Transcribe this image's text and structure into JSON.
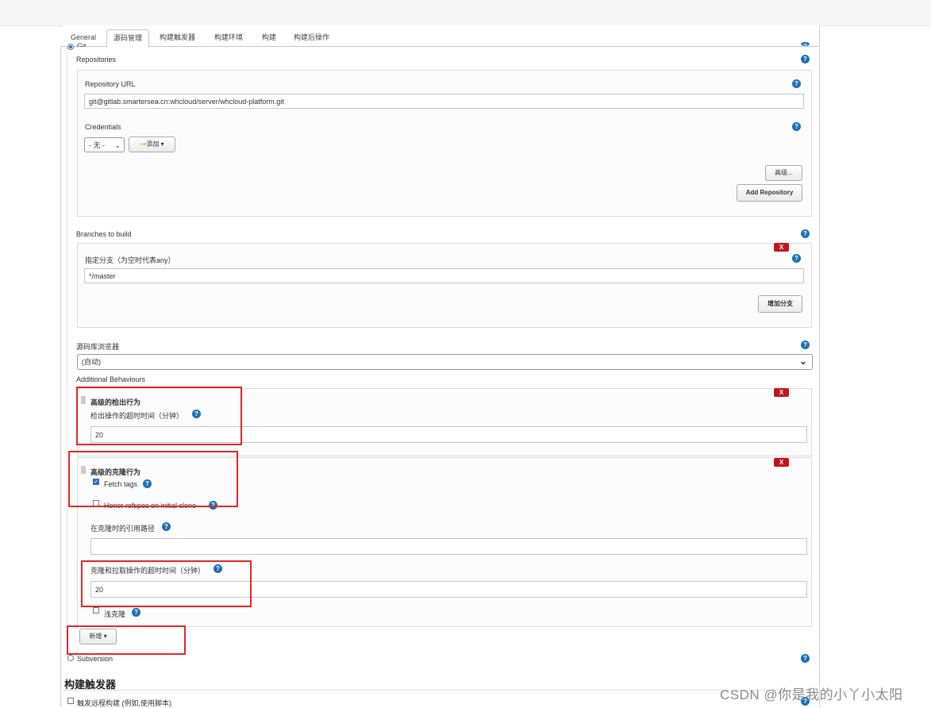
{
  "tabs": [
    "General",
    "源码管理",
    "构建触发器",
    "构建环境",
    "构建",
    "构建后操作"
  ],
  "active_tab_index": 1,
  "scm": {
    "git_radio_label": "Git",
    "repositories_label": "Repositories",
    "repository_url_label": "Repository URL",
    "repository_url_value": "git@gitlab.smartersea.cn:whcloud/server/whcloud-platform.git",
    "credentials_label": "Credentials",
    "credentials_select_value": "- 无 -",
    "add_credentials_label": "添加",
    "advanced_button": "高级...",
    "add_repository_button": "Add Repository",
    "branches_label": "Branches to build",
    "branch_specifier_label": "指定分支（为空时代表any）",
    "branch_specifier_value": "*/master",
    "add_branch_button": "增加分支",
    "repo_browser_label": "源码库浏览器",
    "repo_browser_value": "(自动)",
    "additional_behaviours_label": "Additional Behaviours",
    "checkout_behaviour_title": "高级的检出行为",
    "checkout_timeout_label": "检出操作的超时时间（分钟）",
    "checkout_timeout_value": "20",
    "clone_behaviour_title": "高级的克隆行为",
    "fetch_tags_label": "Fetch tags",
    "honor_refspec_label": "Honor refspec on initial clone",
    "reference_path_label": "在克隆时的引用路径",
    "reference_path_value": "",
    "clone_timeout_label": "克隆和拉取操作的超时时间（分钟）",
    "clone_timeout_value": "20",
    "shallow_clone_label": "浅克隆",
    "add_behaviour_button": "新增",
    "subversion_label": "Subversion",
    "delete_label": "X",
    "help_label": "?"
  },
  "trigger_section_title": "构建触发器",
  "trigger_remote_label": "触发远程构建 (例如,使用脚本)",
  "watermark": "CSDN @你是我的小丫小太阳",
  "colors": {
    "help": "#1d6fb4",
    "delete": "#c0161b",
    "highlight_frame": "#e0262b",
    "checkbox": "#2a6fc9"
  }
}
